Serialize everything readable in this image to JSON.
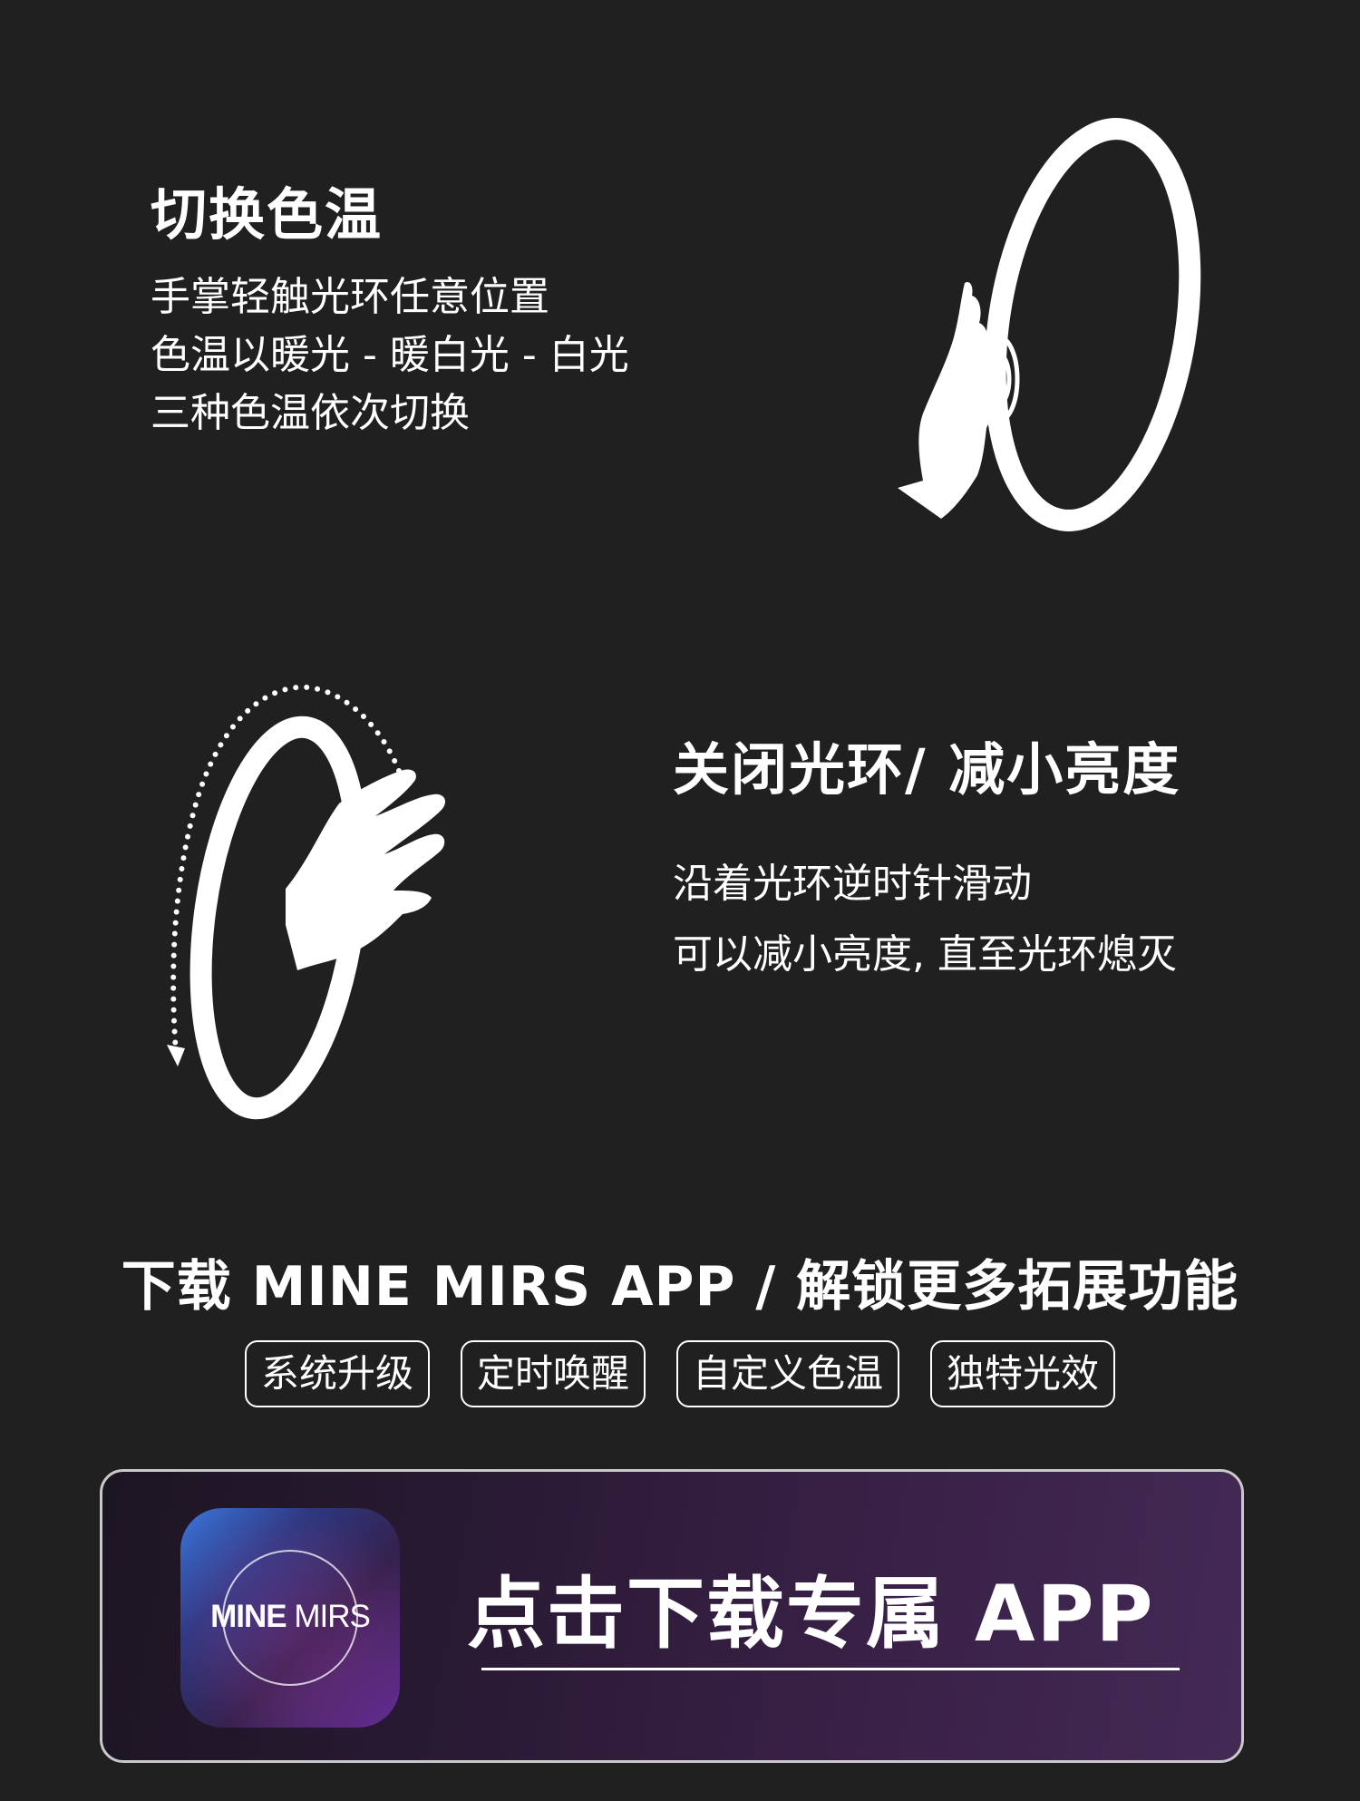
{
  "section1": {
    "title": "切换色温",
    "lines": [
      "手掌轻触光环任意位置",
      "色温以暖光 - 暖白光 - 白光",
      "三种色温依次切换"
    ]
  },
  "section2": {
    "title": "关闭光环/ 减小亮度",
    "lines": [
      "沿着光环逆时针滑动",
      "可以减小亮度, 直至光环熄灭"
    ]
  },
  "download": {
    "headline": "下载 MINE MIRS APP  /  解锁更多拓展功能",
    "tags": [
      "系统升级",
      "定时唤醒",
      "自定义色温",
      "独特光效"
    ],
    "app_icon_brand_bold": "MINE",
    "app_icon_brand_light": "MIRS",
    "cta": "点击下载专属 APP"
  },
  "colors": {
    "background": "#202020",
    "text": "#ffffff",
    "card_gradient_start": "#1c1522",
    "card_gradient_end": "#432a55"
  },
  "icons": [
    "hand-touch-ring-icon",
    "hand-swipe-ring-icon",
    "app-logo-icon"
  ]
}
